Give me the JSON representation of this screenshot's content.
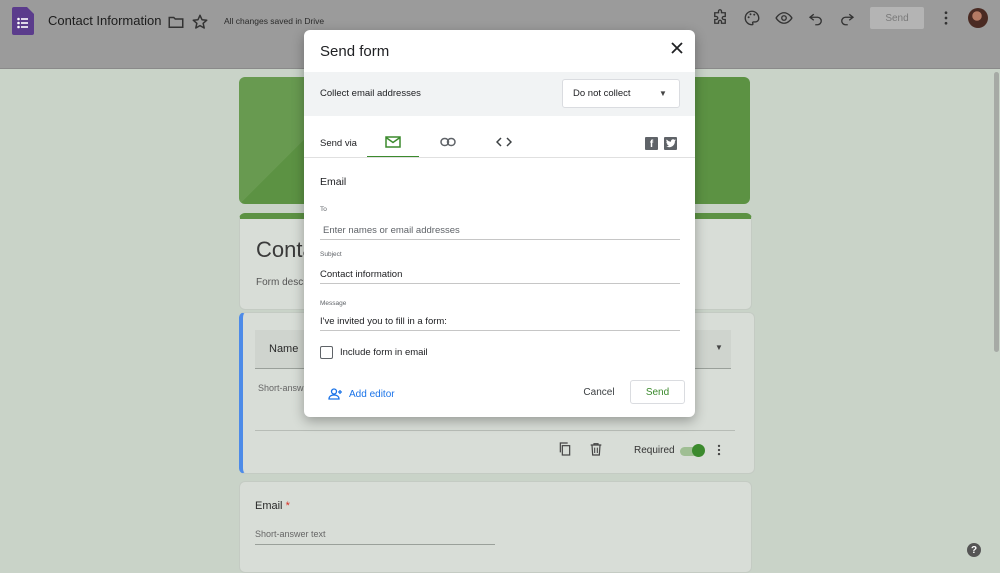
{
  "app": {
    "doc_title": "Contact Information",
    "save_status": "All changes saved in Drive",
    "send_button": "Send",
    "icons": [
      "forms-logo-icon",
      "folder-icon",
      "star-icon",
      "addon-icon",
      "palette-icon",
      "preview-icon",
      "undo-icon",
      "redo-icon",
      "more-vert-icon",
      "avatar"
    ]
  },
  "form": {
    "title": "Conta",
    "description": "Form descr",
    "q1": {
      "label": "Name",
      "placeholder": "Short-answ",
      "required_label": "Required",
      "required_on": true
    },
    "q2": {
      "label": "Email",
      "required_mark": "*",
      "placeholder": "Short-answer text"
    }
  },
  "dialog": {
    "title": "Send form",
    "collect_label": "Collect email addresses",
    "collect_value": "Do not collect",
    "send_via_label": "Send via",
    "tabs": [
      {
        "name": "email",
        "icon": "mail-icon",
        "active": true
      },
      {
        "name": "link",
        "icon": "link-icon",
        "active": false
      },
      {
        "name": "embed",
        "icon": "embed-icon",
        "active": false
      }
    ],
    "social": [
      "facebook-icon",
      "twitter-icon"
    ],
    "section_title": "Email",
    "to": {
      "label": "To",
      "placeholder": "Enter names or email addresses",
      "value": ""
    },
    "subject": {
      "label": "Subject",
      "value": "Contact information"
    },
    "message": {
      "label": "Message",
      "value": "I've invited you to fill in a form:"
    },
    "include_form_label": "Include form in email",
    "include_form_checked": false,
    "add_editor_label": "Add editor",
    "cancel_label": "Cancel",
    "send_label": "Send"
  },
  "colors": {
    "accent": "#3b8a2d",
    "link": "#1a73e8",
    "forms_purple": "#673ab7"
  }
}
